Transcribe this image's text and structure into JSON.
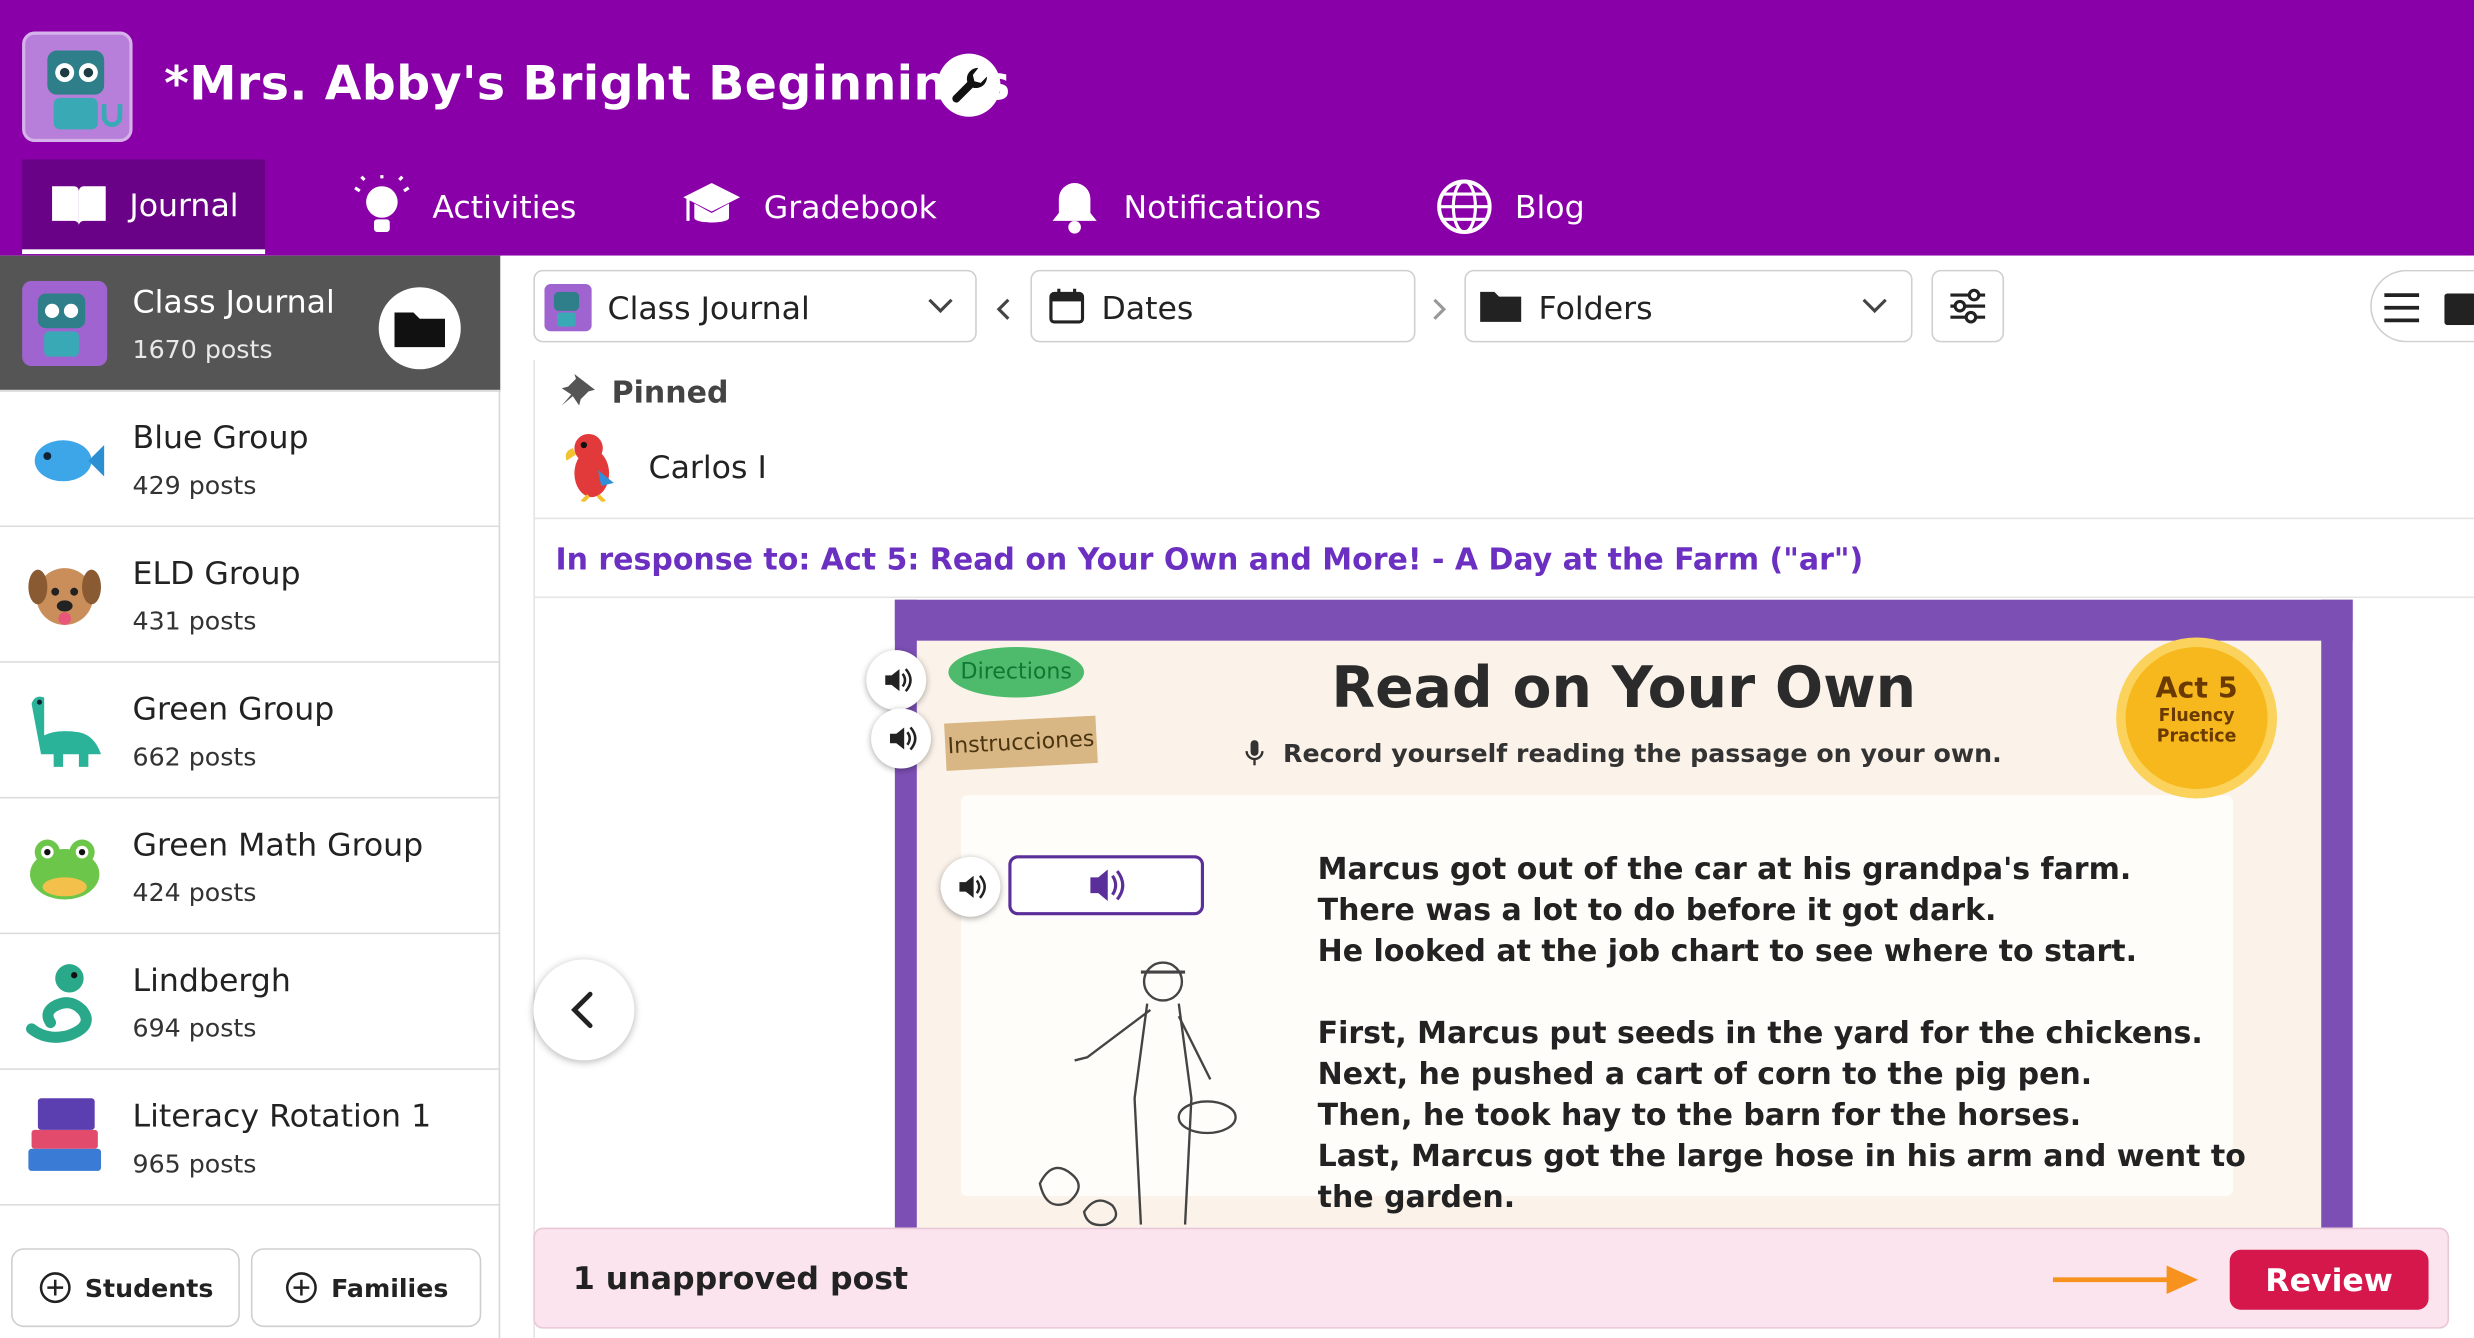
{
  "header": {
    "class_title": "*Mrs. Abby's Bright Beginnings",
    "tabs": [
      {
        "label": "Journal",
        "active": true
      },
      {
        "label": "Activities"
      },
      {
        "label": "Gradebook"
      },
      {
        "label": "Notifications"
      },
      {
        "label": "Blog"
      }
    ],
    "brand_color": "#8a00a8"
  },
  "sidebar": {
    "groups": [
      {
        "name": "Class Journal",
        "count": "1670 posts",
        "active": true,
        "icon": "robot-icon"
      },
      {
        "name": "Blue Group",
        "count": "429 posts",
        "icon": "fish-icon"
      },
      {
        "name": "ELD Group",
        "count": "431 posts",
        "icon": "dog-icon"
      },
      {
        "name": "Green Group",
        "count": "662 posts",
        "icon": "dinosaur-icon"
      },
      {
        "name": "Green Math Group",
        "count": "424 posts",
        "icon": "frog-icon"
      },
      {
        "name": "Lindbergh",
        "count": "694 posts",
        "icon": "snake-icon"
      },
      {
        "name": "Literacy Rotation 1",
        "count": "965 posts",
        "icon": "books-icon"
      }
    ],
    "buttons": {
      "students": "Students",
      "families": "Families"
    }
  },
  "toolbar": {
    "journal_select": "Class Journal",
    "dates": "Dates",
    "folders": "Folders"
  },
  "post": {
    "pinned_label": "Pinned",
    "student_name": "Carlos I",
    "response_label": "In response to: Act 5: Read on Your Own and More! - A Day at the Farm (\"ar\")",
    "activity": {
      "title": "Read on Your Own",
      "subtitle": "Record yourself reading the passage on your own.",
      "directions_tag": "Directions",
      "instructions_tag": "Instrucciones",
      "badge_main": "Act 5",
      "badge_line1": "Fluency",
      "badge_line2": "Practice",
      "passage_lines": [
        "Marcus got out of the car at his grandpa's farm.",
        "There was a lot to do before it got dark.",
        "He looked at the job chart to see where to start.",
        "",
        "First, Marcus put seeds in the yard for the chickens.",
        "Next, he pushed a cart of corn to the pig pen.",
        "Then, he took hay to the barn for the horses.",
        "Last, Marcus got the large hose in his arm and went to",
        "the garden."
      ]
    }
  },
  "banner": {
    "text": "1 unapproved post",
    "review_label": "Review",
    "review_color": "#d6174b"
  }
}
